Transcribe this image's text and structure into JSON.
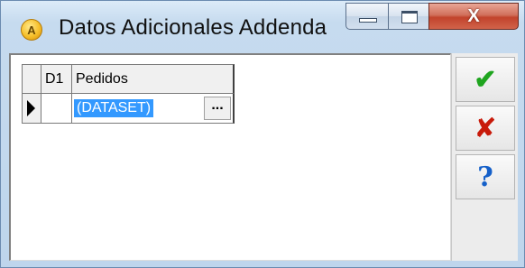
{
  "window": {
    "title": "Datos Adicionales Addenda",
    "app_icon_letter": "A",
    "minimize_icon": "minimize-icon",
    "maximize_icon": "maximize-icon",
    "close_glyph": "X"
  },
  "grid": {
    "columns": [
      {
        "header": "D1"
      },
      {
        "header": "Pedidos"
      }
    ],
    "rows": [
      {
        "current": true,
        "d1": "",
        "pedidos": "(DATASET)",
        "ellipsis": "..."
      }
    ]
  },
  "toolbar": {
    "ok_glyph": "✔",
    "cancel_glyph": "✘",
    "help_glyph": "?"
  },
  "colors": {
    "ok": "#1fa51f",
    "cancel": "#c81a0a",
    "help": "#1560c9",
    "selection": "#3399ff"
  }
}
